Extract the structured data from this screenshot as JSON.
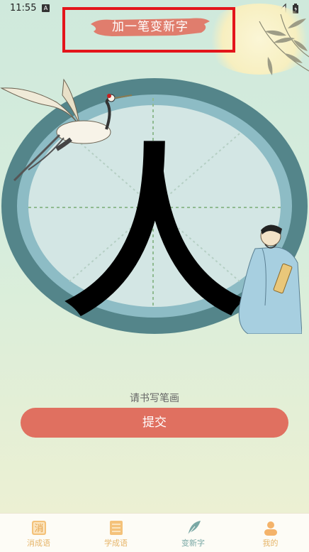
{
  "status_bar": {
    "time": "11:55",
    "notification_glyph": "A",
    "icons": [
      "wifi-icon",
      "signal-icon",
      "battery-icon"
    ]
  },
  "header": {
    "title": "加一笔变新字"
  },
  "canvas": {
    "character": "人"
  },
  "instruction": "请书写笔画",
  "submit_label": "提交",
  "bottom_nav": [
    {
      "label": "消成语",
      "icon_char": "消",
      "icon": "xiao-chengyu-icon"
    },
    {
      "label": "学成语",
      "icon": "book-icon"
    },
    {
      "label": "变新字",
      "icon": "quill-icon",
      "active": true
    },
    {
      "label": "我的",
      "icon": "user-icon"
    }
  ],
  "colors": {
    "ring_outer": "#54858a",
    "ring_inner": "#8dbcc5",
    "canvas_bg": "#d3e6e4",
    "guide_line": "#8fba90",
    "submit_bg": "#e07060",
    "title_frame": "#e3151b",
    "nav_inactive": "#e6b56a",
    "nav_active": "#7aa8a5"
  }
}
